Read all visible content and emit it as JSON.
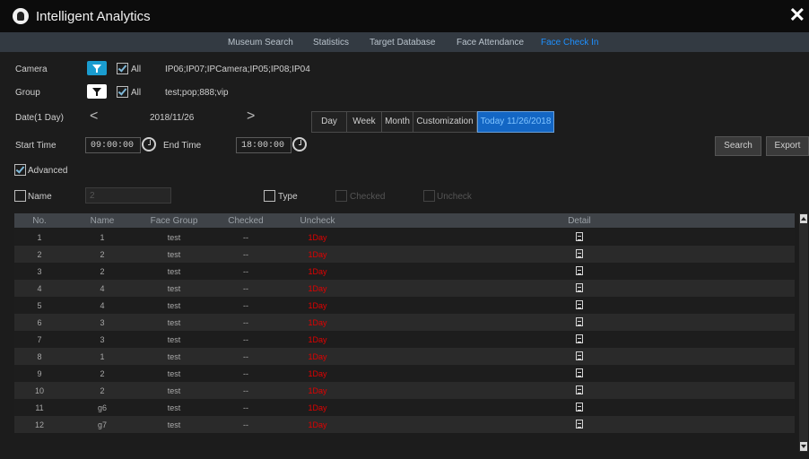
{
  "app": {
    "title": "Intelligent Analytics",
    "close_glyph": "✕"
  },
  "nav": {
    "items": [
      "Museum Search",
      "Statistics",
      "Target Database",
      "Face Attendance",
      "Face Check In"
    ],
    "active_index": 4
  },
  "filters": {
    "camera_label": "Camera",
    "camera_all_label": "All",
    "camera_all_checked": true,
    "camera_value": "IP06;IP07;IPCamera;IP05;IP08;IP04",
    "group_label": "Group",
    "group_all_label": "All",
    "group_all_checked": true,
    "group_value": "test;pop;888;vip"
  },
  "date": {
    "label": "Date(1 Day)",
    "prev_glyph": "<",
    "value": "2018/11/26",
    "next_glyph": ">",
    "ranges": [
      "Day",
      "Week",
      "Month",
      "Customization",
      "Today 11/26/2018"
    ],
    "selected_range_index": 4
  },
  "time": {
    "start_label": "Start Time",
    "start_value": "09:00:00",
    "end_label": "End Time",
    "end_value": "18:00:00"
  },
  "actions": {
    "search_label": "Search",
    "export_label": "Export"
  },
  "advanced": {
    "label": "Advanced",
    "checked": true,
    "name_label": "Name",
    "name_checked": false,
    "name_value": "2",
    "type_label": "Type",
    "type_checked": false,
    "checked_label": "Checked",
    "uncheck_label": "Uncheck"
  },
  "table": {
    "columns": [
      "No.",
      "Name",
      "Face Group",
      "Checked",
      "Uncheck",
      "Detail"
    ],
    "rows": [
      {
        "no": "1",
        "name": "1",
        "group": "test",
        "checked": "--",
        "uncheck": "1Day"
      },
      {
        "no": "2",
        "name": "2",
        "group": "test",
        "checked": "--",
        "uncheck": "1Day"
      },
      {
        "no": "3",
        "name": "2",
        "group": "test",
        "checked": "--",
        "uncheck": "1Day"
      },
      {
        "no": "4",
        "name": "4",
        "group": "test",
        "checked": "--",
        "uncheck": "1Day"
      },
      {
        "no": "5",
        "name": "4",
        "group": "test",
        "checked": "--",
        "uncheck": "1Day"
      },
      {
        "no": "6",
        "name": "3",
        "group": "test",
        "checked": "--",
        "uncheck": "1Day"
      },
      {
        "no": "7",
        "name": "3",
        "group": "test",
        "checked": "--",
        "uncheck": "1Day"
      },
      {
        "no": "8",
        "name": "1",
        "group": "test",
        "checked": "--",
        "uncheck": "1Day"
      },
      {
        "no": "9",
        "name": "2",
        "group": "test",
        "checked": "--",
        "uncheck": "1Day"
      },
      {
        "no": "10",
        "name": "2",
        "group": "test",
        "checked": "--",
        "uncheck": "1Day"
      },
      {
        "no": "11",
        "name": "g6",
        "group": "test",
        "checked": "--",
        "uncheck": "1Day"
      },
      {
        "no": "12",
        "name": "g7",
        "group": "test",
        "checked": "--",
        "uncheck": "1Day"
      }
    ],
    "detail_icon": "document-icon"
  },
  "colors": {
    "accent": "#1a9ccf",
    "today": "#1366c4",
    "uncheck_red": "#e30000",
    "active_nav": "#1e90ff"
  }
}
